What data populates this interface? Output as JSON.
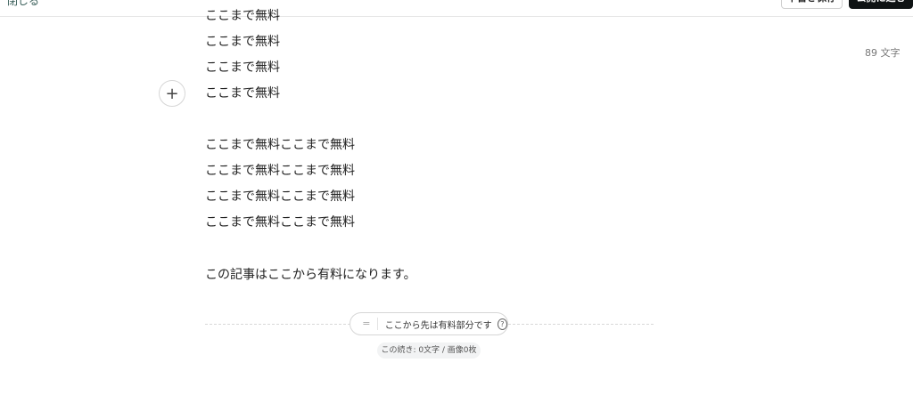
{
  "header": {
    "close_label": "閉じる",
    "save_draft_label": "下書き保存",
    "publish_label": "公開に進む"
  },
  "editor": {
    "char_count": "89 文字",
    "add_block_icon": "plus-icon",
    "lines": [
      "ここまで無料",
      "ここまで無料",
      "ここまで無料",
      "ここまで無料",
      "ここまで無料ここまで無料",
      "ここまで無料ここまで無料",
      "ここまで無料ここまで無料",
      "ここまで無料ここまで無料",
      "この記事はここから有料になります。"
    ]
  },
  "paywall": {
    "label": "ここから先は有料部分です",
    "handle_icon": "drag-handle-icon",
    "help_icon": "question-circle-icon",
    "remaining": "この続き: 0文字 / 画像0枚"
  }
}
